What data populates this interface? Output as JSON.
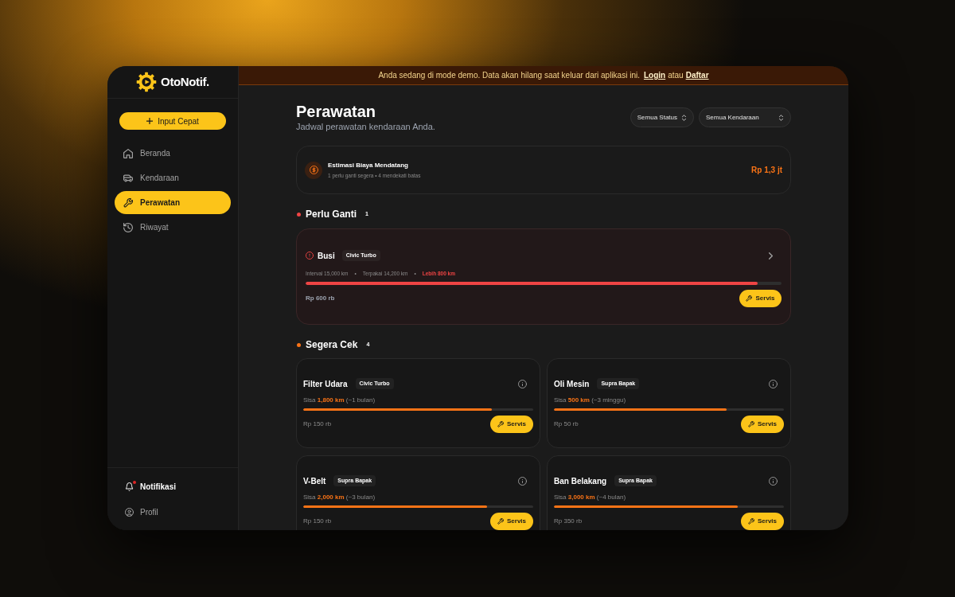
{
  "brand": {
    "name": "OtoNotif."
  },
  "sidebar": {
    "quick_action": {
      "label": "Input Cepat"
    },
    "nav": [
      {
        "label": "Beranda",
        "selected": false
      },
      {
        "label": "Kendaraan",
        "selected": false
      },
      {
        "label": "Perawatan",
        "selected": true
      },
      {
        "label": "Riwayat",
        "selected": false
      }
    ],
    "footer": [
      {
        "label": "Notifikasi",
        "unread": true
      },
      {
        "label": "Profil",
        "unread": false
      }
    ]
  },
  "banner": {
    "message": "Anda sedang di mode demo. Data akan hilang saat keluar dari aplikasi ini.",
    "login_link": "Login",
    "conjunction": "atau",
    "register_link": "Daftar"
  },
  "header": {
    "title": "Perawatan",
    "subtitle": "Jadwal perawatan kendaraan Anda.",
    "filters": [
      {
        "label": "Semua Status"
      },
      {
        "label": "Semua Kendaraan"
      }
    ]
  },
  "summary": {
    "title": "Estimasi Biaya Mendatang",
    "subtitle": "1 perlu ganti segera • 4 mendekati batas",
    "amount": "Rp 1,3 jt"
  },
  "sections": [
    {
      "kind": "overdue",
      "title": "Perlu Ganti",
      "count": "1",
      "items": [
        {
          "name": "Busi",
          "vehicle": "Civic Turbo",
          "details": [
            {
              "kind": "info",
              "text": "Interval 15,000 km"
            },
            {
              "kind": "separator",
              "text": "•"
            },
            {
              "kind": "info",
              "text": "Terpakai 14,200 km"
            },
            {
              "kind": "separator",
              "text": "•"
            },
            {
              "kind": "alert",
              "text": "Lebih 800 km"
            }
          ],
          "level": 0.95,
          "price": "Rp 600 rb",
          "action": "Servis"
        }
      ]
    },
    {
      "kind": "upcoming",
      "title": "Segera Cek",
      "count": "4",
      "items": [
        {
          "name": "Filter Udara",
          "vehicle": "Civic Turbo",
          "remaining": "Sisa **1,800 km** (~1 bulan)",
          "level": 0.82,
          "price": "Rp 150 rb",
          "action": "Servis"
        },
        {
          "name": "Oli Mesin",
          "vehicle": "Supra Bapak",
          "remaining": "Sisa **500 km** (~3 minggu)",
          "level": 0.75,
          "price": "Rp 50 rb",
          "action": "Servis"
        },
        {
          "name": "V-Belt",
          "vehicle": "Supra Bapak",
          "remaining": "Sisa **2,000 km** (~3 bulan)",
          "level": 0.8,
          "price": "Rp 150 rb",
          "action": "Servis"
        },
        {
          "name": "Ban Belakang",
          "vehicle": "Supra Bapak",
          "remaining": "Sisa **3,000 km** (~4 bulan)",
          "level": 0.8,
          "price": "Rp 350 rb",
          "action": "Servis"
        }
      ]
    }
  ]
}
